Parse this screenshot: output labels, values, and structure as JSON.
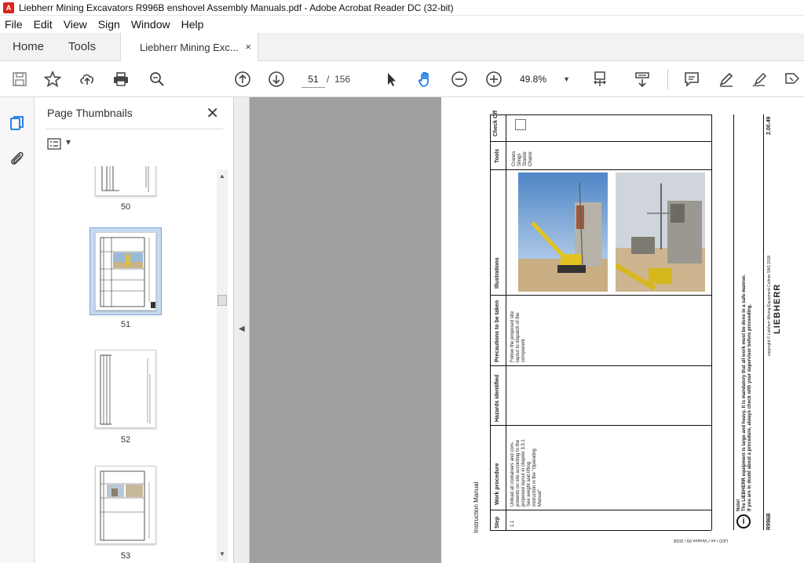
{
  "window": {
    "title": "Liebherr Mining Excavators R996B  enshovel Assembly Manuals.pdf - Adobe Acrobat Reader DC (32-bit)",
    "icon": "pdf-app-icon"
  },
  "menu": [
    "File",
    "Edit",
    "View",
    "Sign",
    "Window",
    "Help"
  ],
  "tabs": {
    "home": "Home",
    "tools": "Tools",
    "document": "Liebherr Mining Exc...",
    "close": "×"
  },
  "toolbar": {
    "current_page": "51",
    "page_separator": "/",
    "total_pages": "156",
    "zoom": "49.8%",
    "zoom_caret": "▼"
  },
  "thumbnails": {
    "title": "Page Thumbnails",
    "close": "✕",
    "options_caret": "▾",
    "pages": [
      {
        "label": "50"
      },
      {
        "label": "51",
        "selected": true
      },
      {
        "label": "52"
      },
      {
        "label": "53"
      }
    ]
  },
  "document": {
    "side_title": "Instruction Manual",
    "footer_left": "LEO / en / Version 09 / 2018",
    "headers": {
      "step": "Step",
      "work": "Work procedure",
      "hazards": "Hazards identified",
      "precautions": "Precautions to be taken",
      "illustrations": "Illustrations",
      "tools": "Tools",
      "check": "Check Off"
    },
    "row": {
      "step": "1.1",
      "work": [
        "Unload all containers and com-",
        "ponents on site according to the",
        "proposed layout in chapter 3.3.1",
        "See weight and lifting",
        "instruction in the \"Operating",
        "Manual\""
      ],
      "precautions": [
        "Follow the proposed site",
        "layout to dispatch of the",
        "component"
      ],
      "tools": [
        "Cranes",
        "Slings",
        "Stands",
        "Chains"
      ]
    },
    "note": {
      "label": "Note!",
      "line1": "The LIEBHERR equipment is large and heavy. It is mandatory that all work must be done in a safe manner.",
      "line2": "If you are in doubt about a procedure, always check with your supervisor before proceeding."
    },
    "model": "R996B",
    "copyright": "copyright © Liebherr-Mining Equipment Colmar SAS 2018",
    "brand": "LIEBHERR",
    "section": "2.00.49"
  },
  "colors": {
    "accent_blue": "#1473e6",
    "pdf_red": "#d7261e",
    "viewport_gray": "#a0a0a0"
  }
}
